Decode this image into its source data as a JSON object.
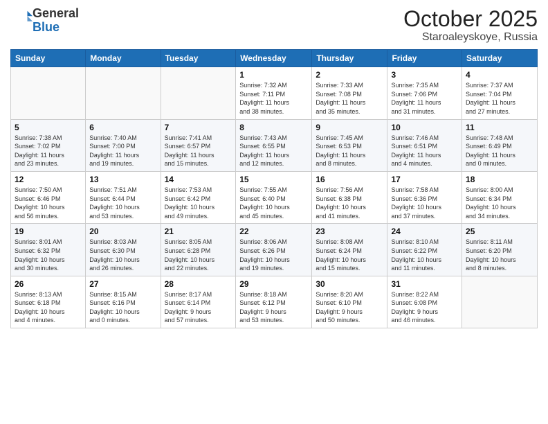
{
  "header": {
    "logo_general": "General",
    "logo_blue": "Blue",
    "month": "October 2025",
    "location": "Staroaleyskoye, Russia"
  },
  "weekdays": [
    "Sunday",
    "Monday",
    "Tuesday",
    "Wednesday",
    "Thursday",
    "Friday",
    "Saturday"
  ],
  "weeks": [
    [
      {
        "day": "",
        "info": ""
      },
      {
        "day": "",
        "info": ""
      },
      {
        "day": "",
        "info": ""
      },
      {
        "day": "1",
        "info": "Sunrise: 7:32 AM\nSunset: 7:11 PM\nDaylight: 11 hours\nand 38 minutes."
      },
      {
        "day": "2",
        "info": "Sunrise: 7:33 AM\nSunset: 7:08 PM\nDaylight: 11 hours\nand 35 minutes."
      },
      {
        "day": "3",
        "info": "Sunrise: 7:35 AM\nSunset: 7:06 PM\nDaylight: 11 hours\nand 31 minutes."
      },
      {
        "day": "4",
        "info": "Sunrise: 7:37 AM\nSunset: 7:04 PM\nDaylight: 11 hours\nand 27 minutes."
      }
    ],
    [
      {
        "day": "5",
        "info": "Sunrise: 7:38 AM\nSunset: 7:02 PM\nDaylight: 11 hours\nand 23 minutes."
      },
      {
        "day": "6",
        "info": "Sunrise: 7:40 AM\nSunset: 7:00 PM\nDaylight: 11 hours\nand 19 minutes."
      },
      {
        "day": "7",
        "info": "Sunrise: 7:41 AM\nSunset: 6:57 PM\nDaylight: 11 hours\nand 15 minutes."
      },
      {
        "day": "8",
        "info": "Sunrise: 7:43 AM\nSunset: 6:55 PM\nDaylight: 11 hours\nand 12 minutes."
      },
      {
        "day": "9",
        "info": "Sunrise: 7:45 AM\nSunset: 6:53 PM\nDaylight: 11 hours\nand 8 minutes."
      },
      {
        "day": "10",
        "info": "Sunrise: 7:46 AM\nSunset: 6:51 PM\nDaylight: 11 hours\nand 4 minutes."
      },
      {
        "day": "11",
        "info": "Sunrise: 7:48 AM\nSunset: 6:49 PM\nDaylight: 11 hours\nand 0 minutes."
      }
    ],
    [
      {
        "day": "12",
        "info": "Sunrise: 7:50 AM\nSunset: 6:46 PM\nDaylight: 10 hours\nand 56 minutes."
      },
      {
        "day": "13",
        "info": "Sunrise: 7:51 AM\nSunset: 6:44 PM\nDaylight: 10 hours\nand 53 minutes."
      },
      {
        "day": "14",
        "info": "Sunrise: 7:53 AM\nSunset: 6:42 PM\nDaylight: 10 hours\nand 49 minutes."
      },
      {
        "day": "15",
        "info": "Sunrise: 7:55 AM\nSunset: 6:40 PM\nDaylight: 10 hours\nand 45 minutes."
      },
      {
        "day": "16",
        "info": "Sunrise: 7:56 AM\nSunset: 6:38 PM\nDaylight: 10 hours\nand 41 minutes."
      },
      {
        "day": "17",
        "info": "Sunrise: 7:58 AM\nSunset: 6:36 PM\nDaylight: 10 hours\nand 37 minutes."
      },
      {
        "day": "18",
        "info": "Sunrise: 8:00 AM\nSunset: 6:34 PM\nDaylight: 10 hours\nand 34 minutes."
      }
    ],
    [
      {
        "day": "19",
        "info": "Sunrise: 8:01 AM\nSunset: 6:32 PM\nDaylight: 10 hours\nand 30 minutes."
      },
      {
        "day": "20",
        "info": "Sunrise: 8:03 AM\nSunset: 6:30 PM\nDaylight: 10 hours\nand 26 minutes."
      },
      {
        "day": "21",
        "info": "Sunrise: 8:05 AM\nSunset: 6:28 PM\nDaylight: 10 hours\nand 22 minutes."
      },
      {
        "day": "22",
        "info": "Sunrise: 8:06 AM\nSunset: 6:26 PM\nDaylight: 10 hours\nand 19 minutes."
      },
      {
        "day": "23",
        "info": "Sunrise: 8:08 AM\nSunset: 6:24 PM\nDaylight: 10 hours\nand 15 minutes."
      },
      {
        "day": "24",
        "info": "Sunrise: 8:10 AM\nSunset: 6:22 PM\nDaylight: 10 hours\nand 11 minutes."
      },
      {
        "day": "25",
        "info": "Sunrise: 8:11 AM\nSunset: 6:20 PM\nDaylight: 10 hours\nand 8 minutes."
      }
    ],
    [
      {
        "day": "26",
        "info": "Sunrise: 8:13 AM\nSunset: 6:18 PM\nDaylight: 10 hours\nand 4 minutes."
      },
      {
        "day": "27",
        "info": "Sunrise: 8:15 AM\nSunset: 6:16 PM\nDaylight: 10 hours\nand 0 minutes."
      },
      {
        "day": "28",
        "info": "Sunrise: 8:17 AM\nSunset: 6:14 PM\nDaylight: 9 hours\nand 57 minutes."
      },
      {
        "day": "29",
        "info": "Sunrise: 8:18 AM\nSunset: 6:12 PM\nDaylight: 9 hours\nand 53 minutes."
      },
      {
        "day": "30",
        "info": "Sunrise: 8:20 AM\nSunset: 6:10 PM\nDaylight: 9 hours\nand 50 minutes."
      },
      {
        "day": "31",
        "info": "Sunrise: 8:22 AM\nSunset: 6:08 PM\nDaylight: 9 hours\nand 46 minutes."
      },
      {
        "day": "",
        "info": ""
      }
    ]
  ]
}
